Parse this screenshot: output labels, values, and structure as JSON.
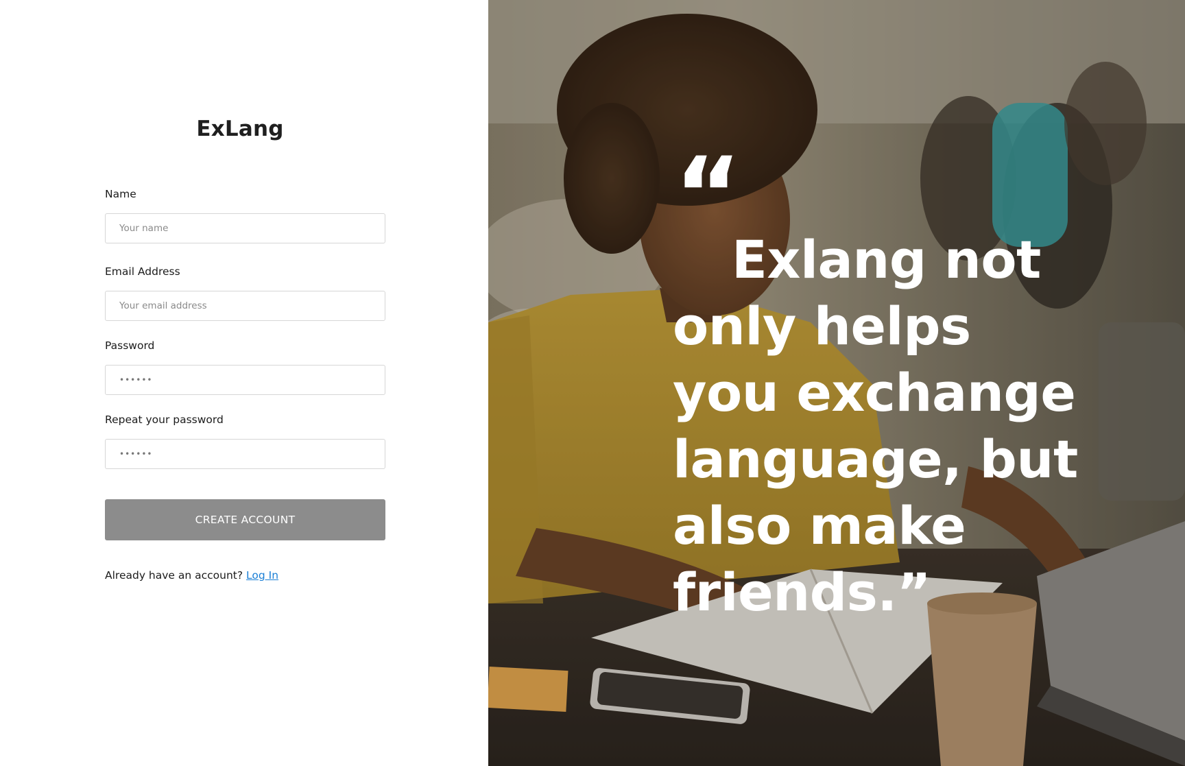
{
  "brand": {
    "name": "ExLang"
  },
  "form": {
    "name": {
      "label": "Name",
      "placeholder": "Your name"
    },
    "email": {
      "label": "Email Address",
      "placeholder": "Your email address"
    },
    "password": {
      "label": "Password",
      "value": "••••••"
    },
    "repeat_password": {
      "label": "Repeat your password",
      "value": "••••••"
    },
    "submit_label": "CREATE ACCOUNT",
    "login_prompt": "Already have an account?",
    "login_link": "Log In"
  },
  "hero": {
    "quote_mark": "“",
    "quote_text": "Exlang not only helps you exchange language, but also make friends.”"
  },
  "colors": {
    "button_bg": "#8c8c8c",
    "link": "#1a7fd6",
    "shirt": "#c9a434"
  }
}
